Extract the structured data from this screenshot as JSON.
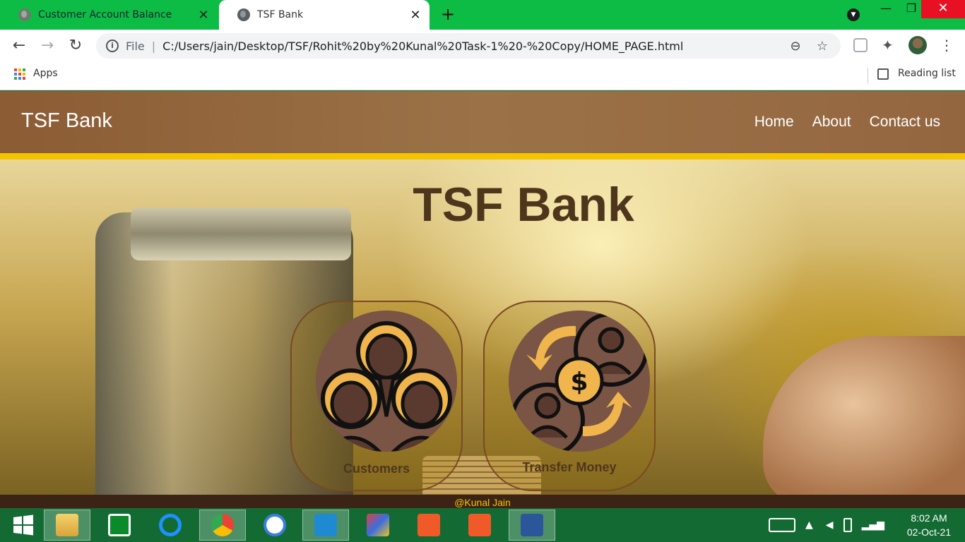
{
  "browser": {
    "tabs": [
      {
        "label": "Customer Account Balance"
      },
      {
        "label": "TSF Bank"
      }
    ],
    "address": {
      "scheme_label": "File",
      "url": "C:/Users/jain/Desktop/TSF/Rohit%20by%20Kunal%20Task-1%20-%20Copy/HOME_PAGE.html"
    },
    "bookmarks": {
      "apps_label": "Apps",
      "reading_list_label": "Reading list"
    }
  },
  "site": {
    "brand": "TSF Bank",
    "nav": [
      "Home",
      "About",
      "Contact us"
    ],
    "hero_title": "TSF Bank",
    "cards": [
      {
        "label": "Customers"
      },
      {
        "label": "Transfer Money"
      }
    ],
    "footer": "@Kunal Jain"
  },
  "taskbar": {
    "time": "8:02 AM",
    "date": "02-Oct-21"
  },
  "colors": {
    "tab_strip": "#0cbc44",
    "header": "#946640",
    "accent": "#f4c400",
    "text_brown": "#4e361d",
    "taskbar": "#136b33"
  }
}
